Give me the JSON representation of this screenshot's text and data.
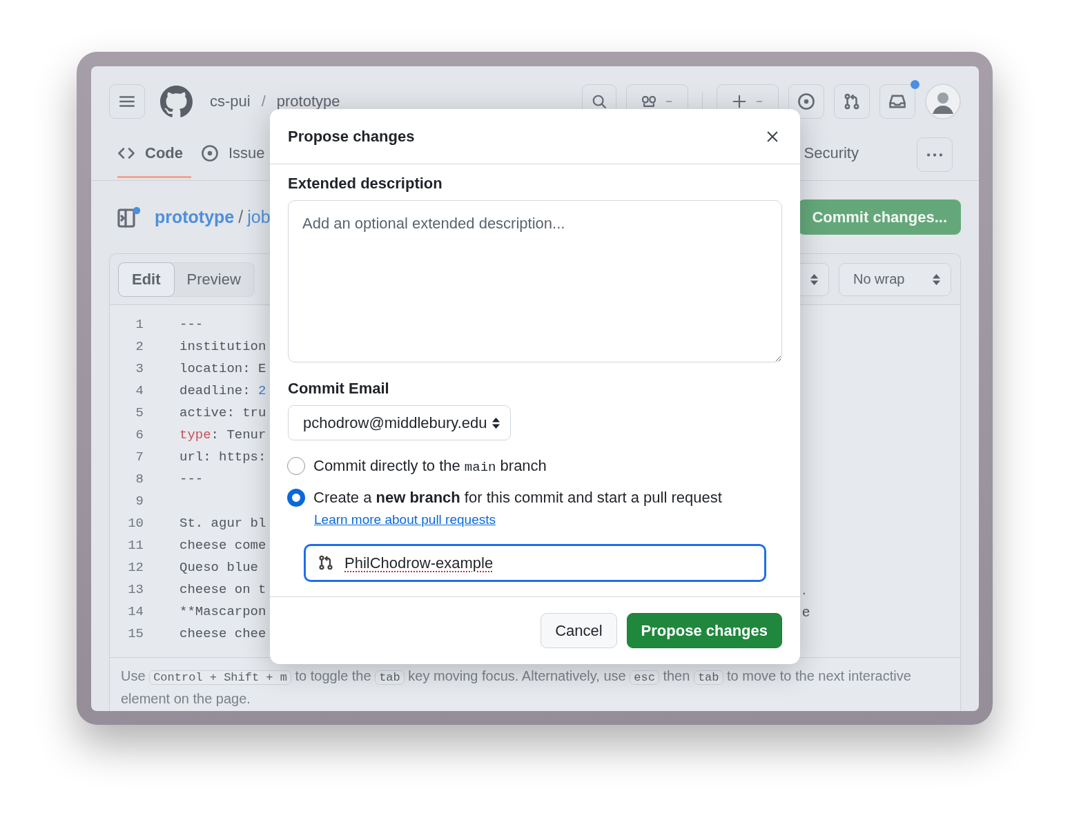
{
  "header": {
    "owner": "cs-pui",
    "separator": "/",
    "repo": "prototype"
  },
  "nav": {
    "tabs": [
      {
        "label": "Code",
        "selected": true,
        "kind": "code"
      },
      {
        "label": "Issue",
        "selected": false,
        "kind": "issue"
      },
      {
        "label": "Security",
        "selected": false,
        "kind": "plain"
      }
    ]
  },
  "breadcrumb": {
    "repo": "prototype",
    "separator": "/",
    "file": "job"
  },
  "commit_button": "Commit changes...",
  "editor": {
    "modes": [
      {
        "label": "Edit",
        "selected": true
      },
      {
        "label": "Preview",
        "selected": false
      }
    ],
    "wrap_select": "No wrap",
    "lines": [
      {
        "number": "1",
        "segments": [
          {
            "kind": "plain",
            "text": "---"
          }
        ]
      },
      {
        "number": "2",
        "segments": [
          {
            "kind": "plain",
            "text": "institution"
          }
        ]
      },
      {
        "number": "3",
        "segments": [
          {
            "kind": "plain",
            "text": "location: E"
          }
        ]
      },
      {
        "number": "4",
        "segments": [
          {
            "kind": "plain",
            "text": "deadline: "
          },
          {
            "kind": "number",
            "text": "2"
          }
        ]
      },
      {
        "number": "5",
        "segments": [
          {
            "kind": "plain",
            "text": "active: tru"
          }
        ]
      },
      {
        "number": "6",
        "segments": [
          {
            "kind": "keyword",
            "text": "type"
          },
          {
            "kind": "plain",
            "text": ": Tenur"
          }
        ]
      },
      {
        "number": "7",
        "segments": [
          {
            "kind": "plain",
            "text": "url: https:"
          }
        ]
      },
      {
        "number": "8",
        "segments": [
          {
            "kind": "plain",
            "text": "---"
          }
        ]
      },
      {
        "number": "9"
      },
      {
        "number": "10",
        "segments": [
          {
            "kind": "plain",
            "text": "St. agur bl"
          }
        ]
      },
      {
        "number": "11",
        "segments": [
          {
            "kind": "plain",
            "text": "cheese come"
          }
        ]
      },
      {
        "number": "12",
        "segments": [
          {
            "kind": "plain",
            "text": "Queso blue"
          }
        ]
      },
      {
        "number": "13",
        "segments": [
          {
            "kind": "plain",
            "text": "cheese on t"
          }
        ],
        "tail": "."
      },
      {
        "number": "14",
        "segments": [
          {
            "kind": "plain",
            "text": "**Mascarpon"
          }
        ],
        "tail": "e"
      },
      {
        "number": "15",
        "segments": [
          {
            "kind": "plain",
            "text": "cheese chee"
          }
        ]
      }
    ],
    "hint": [
      {
        "kind": "text",
        "text": "Use "
      },
      {
        "kind": "key",
        "text": "Control + Shift + m"
      },
      {
        "kind": "text",
        "text": " to toggle the "
      },
      {
        "kind": "key",
        "text": "tab"
      },
      {
        "kind": "text",
        "text": " key moving focus. Alternatively, use "
      },
      {
        "kind": "key",
        "text": "esc"
      },
      {
        "kind": "text",
        "text": " then "
      },
      {
        "kind": "key",
        "text": "tab"
      },
      {
        "kind": "text",
        "text": " to move to the next interactive element on the page."
      }
    ]
  },
  "modal": {
    "title": "Propose changes",
    "description_label": "Extended description",
    "description_placeholder": "Add an optional extended description...",
    "email_label": "Commit Email",
    "email": "pchodrow@middlebury.edu",
    "options": [
      {
        "selected": false,
        "segments": [
          {
            "kind": "text",
            "text": "Commit directly to the "
          },
          {
            "kind": "code",
            "text": "main"
          },
          {
            "kind": "text",
            "text": " branch"
          }
        ]
      },
      {
        "selected": true,
        "segments": [
          {
            "kind": "text",
            "text": "Create a "
          },
          {
            "kind": "bold",
            "text": "new branch"
          },
          {
            "kind": "text",
            "text": " for this commit and start a pull request"
          }
        ],
        "link": "Learn more about pull requests"
      }
    ],
    "branch_name": "PhilChodrow-example",
    "buttons": [
      {
        "label": "Cancel",
        "kind": "secondary"
      },
      {
        "label": "Propose changes",
        "kind": "primary"
      }
    ]
  }
}
